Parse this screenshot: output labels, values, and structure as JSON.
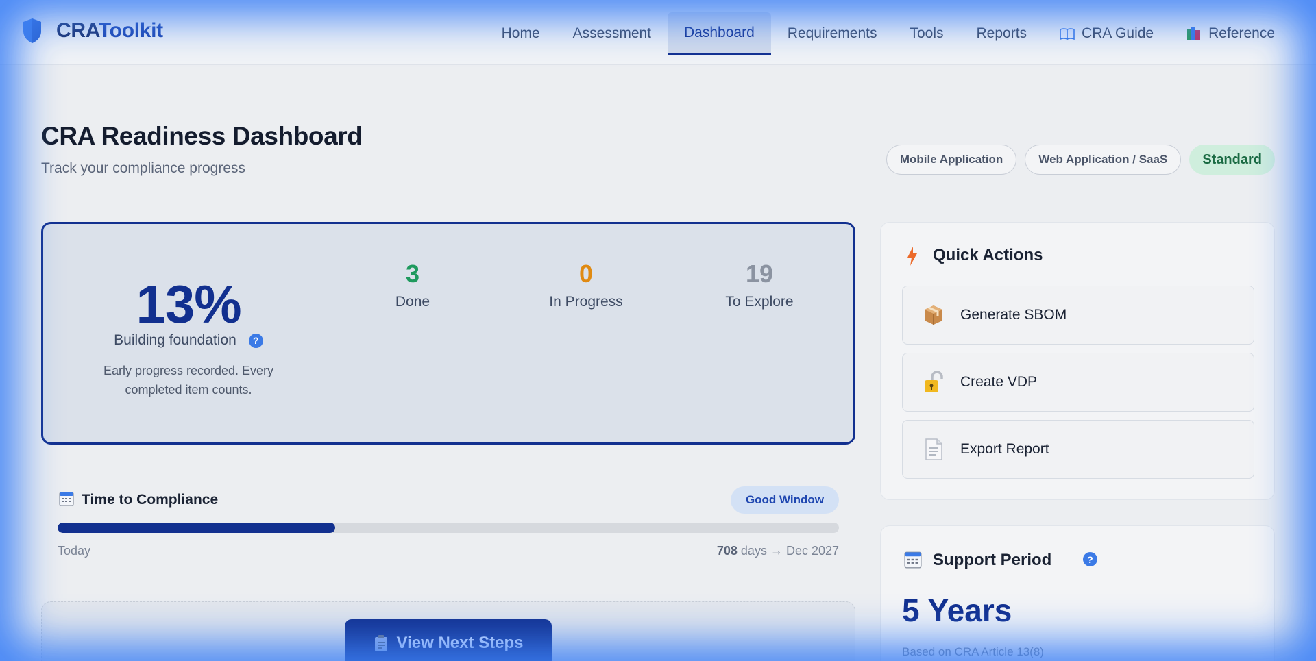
{
  "brand": {
    "name_a": "CRA",
    "name_b": "Toolkit"
  },
  "nav": {
    "items": [
      {
        "label": "Home",
        "icon": ""
      },
      {
        "label": "Assessment",
        "icon": ""
      },
      {
        "label": "Dashboard",
        "icon": "",
        "active": true
      },
      {
        "label": "Requirements",
        "icon": ""
      },
      {
        "label": "Tools",
        "icon": ""
      },
      {
        "label": "Reports",
        "icon": ""
      },
      {
        "label": "CRA Guide",
        "icon": "open-book-icon"
      },
      {
        "label": "Reference",
        "icon": "books-icon"
      }
    ]
  },
  "header": {
    "title": "CRA Readiness Dashboard",
    "subtitle": "Track your compliance progress",
    "chips": [
      "Mobile Application",
      "Web Application / SaaS"
    ],
    "tier": "Standard"
  },
  "progress": {
    "percent": "13%",
    "label": "Building foundation",
    "help": "?",
    "description": "Early progress recorded. Every completed item counts.",
    "stats": [
      {
        "value": "3",
        "label": "Done",
        "color": "#1f9a5e"
      },
      {
        "value": "0",
        "label": "In Progress",
        "color": "#e08a12"
      },
      {
        "value": "19",
        "label": "To Explore",
        "color": "#8b93a1"
      }
    ]
  },
  "quick_actions": {
    "title": "Quick Actions",
    "items": [
      {
        "label": "Generate SBOM",
        "icon": "package-icon"
      },
      {
        "label": "Create VDP",
        "icon": "lock-icon"
      },
      {
        "label": "Export Report",
        "icon": "document-icon"
      }
    ]
  },
  "timeline": {
    "title": "Time to Compliance",
    "badge": "Good Window",
    "progress_fraction": 0.355,
    "start_label": "Today",
    "days": "708",
    "end_label": "days → Dec 2027"
  },
  "next_steps": {
    "button": "View Next Steps"
  },
  "support": {
    "title": "Support Period",
    "help": "?",
    "value": "5 Years",
    "note": "Based on CRA Article 13(8)"
  },
  "colors": {
    "accent": "#12308f",
    "brand": "#1e46b0",
    "success": "#1f9a5e",
    "warning": "#e08a12"
  }
}
